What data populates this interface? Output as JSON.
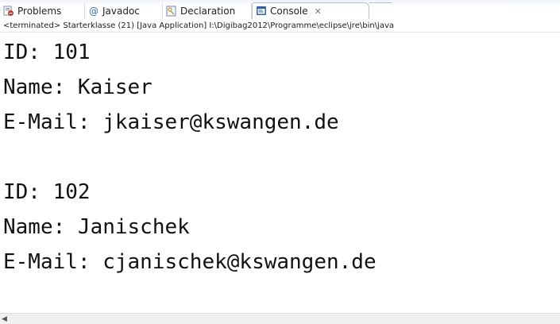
{
  "tabs": [
    {
      "label": "Problems",
      "icon": "problems-icon"
    },
    {
      "label": "Javadoc",
      "icon": "at-icon"
    },
    {
      "label": "Declaration",
      "icon": "declaration-icon"
    },
    {
      "label": "Console",
      "icon": "console-icon",
      "active": true
    }
  ],
  "close_glyph": "✕",
  "status_line": "<terminated> Starterklasse (21) [Java Application] I:\\Digibag2012\\Programme\\eclipse\\jre\\bin\\java",
  "output": [
    "ID: 101",
    "Name: Kaiser",
    "E-Mail: jkaiser@kswangen.de",
    "",
    "ID: 102",
    "Name: Janischek",
    "E-Mail: cjanischek@kswangen.de"
  ],
  "colors": {
    "tab_border": "#b3c0d4",
    "console_icon": "#2f5fa8",
    "problems_icon": "#c0392b",
    "javadoc_icon": "#3b6bb5"
  }
}
